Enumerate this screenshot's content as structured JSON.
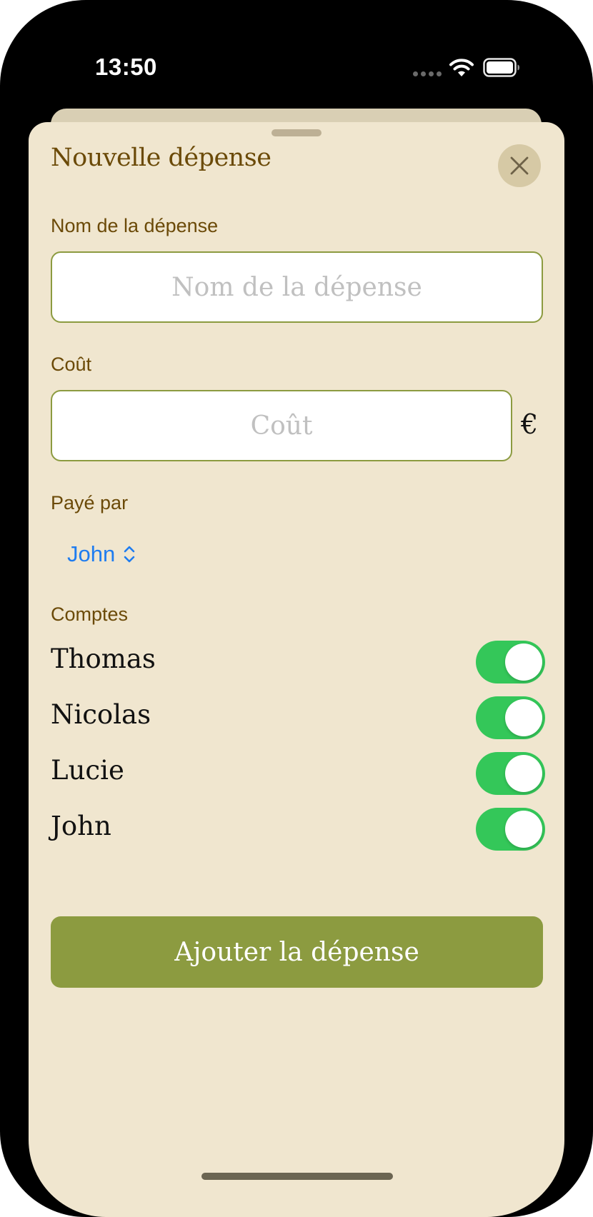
{
  "status_bar": {
    "time": "13:50",
    "signal_icon": "cellular-dots-icon",
    "wifi_icon": "wifi-icon",
    "battery_icon": "battery-icon"
  },
  "sheet": {
    "title": "Nouvelle dépense",
    "close_icon": "close-icon"
  },
  "form": {
    "name": {
      "label": "Nom de la dépense",
      "value": "",
      "placeholder": "Nom de la dépense"
    },
    "cost": {
      "label": "Coût",
      "value": "",
      "placeholder": "Coût",
      "currency": "€"
    },
    "paid_by": {
      "label": "Payé par",
      "selected": "John",
      "icon": "chevron-up-down-icon"
    },
    "accounts": {
      "label": "Comptes",
      "items": [
        {
          "name": "Thomas",
          "enabled": true
        },
        {
          "name": "Nicolas",
          "enabled": true
        },
        {
          "name": "Lucie",
          "enabled": true
        },
        {
          "name": "John",
          "enabled": true
        }
      ]
    },
    "submit_label": "Ajouter la dépense"
  },
  "colors": {
    "sheet_background": "#f0e6cf",
    "label_brown": "#6b4a08",
    "accent_olive": "#8c9b40",
    "toggle_green": "#34c759",
    "link_blue": "#1e7cf0"
  }
}
